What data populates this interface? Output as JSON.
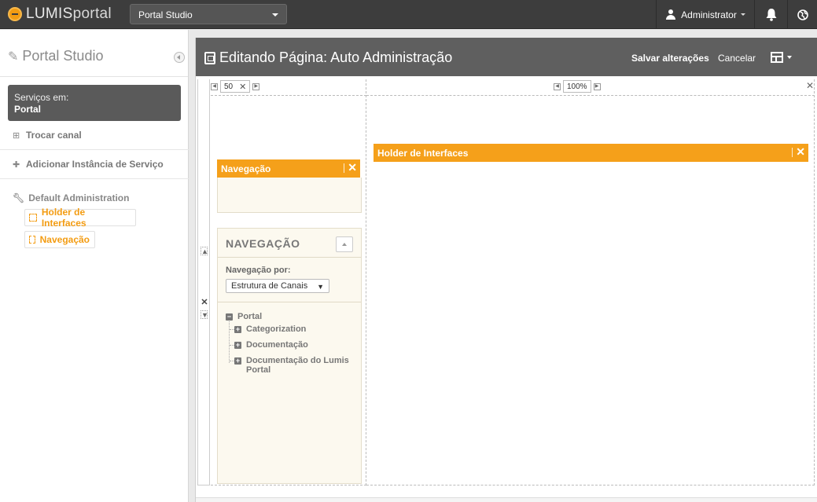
{
  "topbar": {
    "logo_a": "LUMIS",
    "logo_b": "portal",
    "studio_select": "Portal Studio",
    "user": "Administrator"
  },
  "sidebar": {
    "title": "Portal Studio",
    "services_label": "Serviços em:",
    "services_value": "Portal",
    "trocar_canal": "Trocar canal",
    "adicionar_instancia": "Adicionar Instância de Serviço",
    "tree_root": "Default Administration",
    "items": [
      {
        "label": "Holder de Interfaces"
      },
      {
        "label": "Navegação"
      }
    ]
  },
  "editor": {
    "title": "Editando Página: Auto Administração",
    "save": "Salvar alterações",
    "cancel": "Cancelar",
    "col1_size": "50",
    "col2_size": "100%",
    "nav_bar": "Navegação",
    "holder_bar": "Holder de Interfaces",
    "nav_panel": {
      "title": "NAVEGAÇÃO",
      "filter_label": "Navegação por:",
      "filter_value": "Estrutura de Canais",
      "tree": [
        {
          "label": "Portal",
          "sign": "−"
        },
        {
          "label": "Categorization",
          "sign": "+"
        },
        {
          "label": "Documentação",
          "sign": "+"
        },
        {
          "label": "Documentação do Lumis Portal",
          "sign": "+"
        }
      ]
    }
  }
}
